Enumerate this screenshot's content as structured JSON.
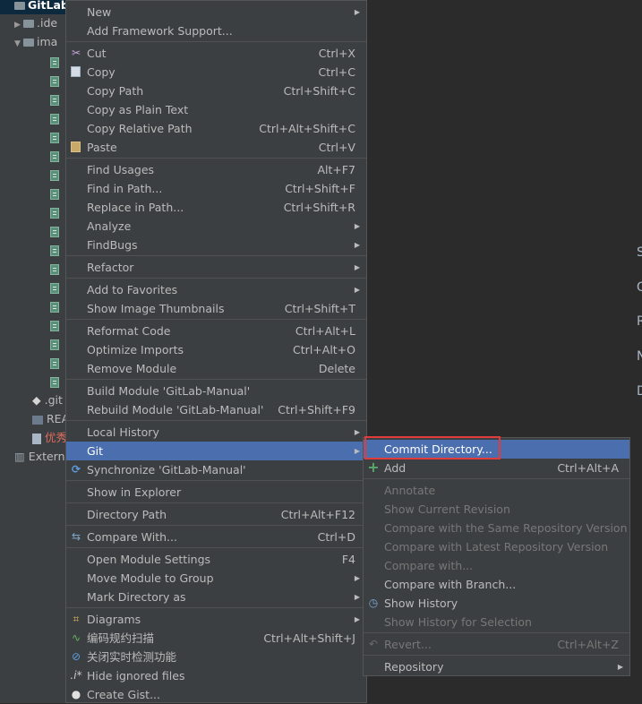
{
  "tree": {
    "root": "GitLab",
    "items": [
      {
        "label": ".ide"
      },
      {
        "label": "ima"
      },
      {
        "label": ".git"
      },
      {
        "label": "REA"
      },
      {
        "label": "优秀"
      },
      {
        "label": "Externa"
      }
    ]
  },
  "editor_letters": [
    "S",
    "G",
    "R",
    "N",
    "D"
  ],
  "context_menu": [
    {
      "label": "New",
      "shortcut": "",
      "submenu": true
    },
    {
      "label": "Add Framework Support...",
      "shortcut": ""
    },
    {
      "label": "Cut",
      "shortcut": "Ctrl+X",
      "icon": "scissors-icon"
    },
    {
      "label": "Copy",
      "shortcut": "Ctrl+C",
      "icon": "copy-icon"
    },
    {
      "label": "Copy Path",
      "shortcut": "Ctrl+Shift+C"
    },
    {
      "label": "Copy as Plain Text",
      "shortcut": ""
    },
    {
      "label": "Copy Relative Path",
      "shortcut": "Ctrl+Alt+Shift+C"
    },
    {
      "label": "Paste",
      "shortcut": "Ctrl+V",
      "icon": "clipboard-icon"
    },
    {
      "label": "Find Usages",
      "shortcut": "Alt+F7"
    },
    {
      "label": "Find in Path...",
      "shortcut": "Ctrl+Shift+F"
    },
    {
      "label": "Replace in Path...",
      "shortcut": "Ctrl+Shift+R"
    },
    {
      "label": "Analyze",
      "shortcut": "",
      "submenu": true
    },
    {
      "label": "FindBugs",
      "shortcut": "",
      "submenu": true
    },
    {
      "label": "Refactor",
      "shortcut": "",
      "submenu": true
    },
    {
      "label": "Add to Favorites",
      "shortcut": "",
      "submenu": true
    },
    {
      "label": "Show Image Thumbnails",
      "shortcut": "Ctrl+Shift+T"
    },
    {
      "label": "Reformat Code",
      "shortcut": "Ctrl+Alt+L"
    },
    {
      "label": "Optimize Imports",
      "shortcut": "Ctrl+Alt+O"
    },
    {
      "label": "Remove Module",
      "shortcut": "Delete"
    },
    {
      "label": "Build Module 'GitLab-Manual'",
      "shortcut": ""
    },
    {
      "label": "Rebuild Module 'GitLab-Manual'",
      "shortcut": "Ctrl+Shift+F9"
    },
    {
      "label": "Local History",
      "shortcut": "",
      "submenu": true
    },
    {
      "label": "Git",
      "shortcut": "",
      "submenu": true
    },
    {
      "label": "Synchronize 'GitLab-Manual'",
      "shortcut": "",
      "icon": "sync-icon"
    },
    {
      "label": "Show in Explorer",
      "shortcut": ""
    },
    {
      "label": "Directory Path",
      "shortcut": "Ctrl+Alt+F12"
    },
    {
      "label": "Compare With...",
      "shortcut": "Ctrl+D",
      "icon": "compare-icon"
    },
    {
      "label": "Open Module Settings",
      "shortcut": "F4"
    },
    {
      "label": "Move Module to Group",
      "shortcut": "",
      "submenu": true
    },
    {
      "label": "Mark Directory as",
      "shortcut": "",
      "submenu": true
    },
    {
      "label": "Diagrams",
      "shortcut": "",
      "submenu": true,
      "icon": "diagram-icon"
    },
    {
      "label": "编码规约扫描",
      "shortcut": "Ctrl+Alt+Shift+J",
      "icon": "scan-icon"
    },
    {
      "label": "关闭实时检测功能",
      "shortcut": "",
      "icon": "disable-icon"
    },
    {
      "label": "Hide ignored files",
      "shortcut": "",
      "icon": "ignore-icon"
    },
    {
      "label": "Create Gist...",
      "shortcut": "",
      "icon": "github-icon"
    }
  ],
  "git_submenu": [
    {
      "label": "Commit Directory...",
      "shortcut": ""
    },
    {
      "label": "Add",
      "shortcut": "Ctrl+Alt+A",
      "icon": "plus-icon"
    },
    {
      "label": "Annotate",
      "shortcut": "",
      "disabled": true
    },
    {
      "label": "Show Current Revision",
      "shortcut": "",
      "disabled": true
    },
    {
      "label": "Compare with the Same Repository Version",
      "shortcut": "",
      "disabled": true
    },
    {
      "label": "Compare with Latest Repository Version",
      "shortcut": "",
      "disabled": true
    },
    {
      "label": "Compare with...",
      "shortcut": "",
      "disabled": true
    },
    {
      "label": "Compare with Branch...",
      "shortcut": ""
    },
    {
      "label": "Show History",
      "shortcut": "",
      "icon": "history-icon"
    },
    {
      "label": "Show History for Selection",
      "shortcut": "",
      "disabled": true
    },
    {
      "label": "Revert...",
      "shortcut": "Ctrl+Alt+Z",
      "disabled": true,
      "icon": "revert-icon"
    },
    {
      "label": "Repository",
      "shortcut": "",
      "submenu": true
    }
  ],
  "colors": {
    "selection": "#4b6eaf",
    "highlight_box": "#e23b3b",
    "menu_bg": "#3c3f41"
  }
}
